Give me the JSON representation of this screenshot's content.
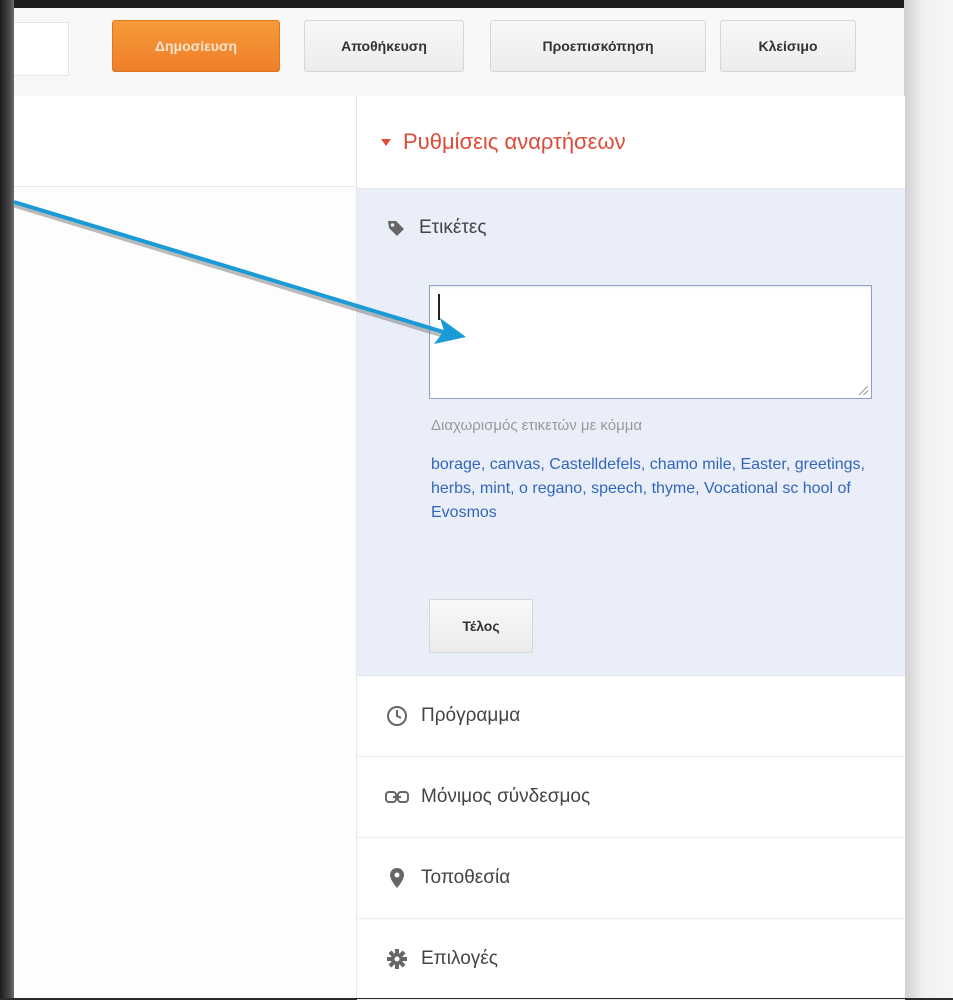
{
  "toolbar": {
    "publish_label": "Δημοσίευση",
    "save_label": "Αποθήκευση",
    "preview_label": "Προεπισκόπηση",
    "close_label": "Κλείσιμο"
  },
  "sidebar": {
    "header": "Ρυθμίσεις αναρτήσεων",
    "labels_panel": {
      "title": "Ετικέτες",
      "input_value": "",
      "hint": "Διαχωρισμός ετικετών με κόμμα",
      "suggested_labels": "borage, canvas, Castelldefels, chamo mile, Easter, greetings, herbs, mint, o regano, speech, thyme, Vocational sc hool of Evosmos",
      "done_label": "Τέλος"
    },
    "items": [
      {
        "label": "Πρόγραμμα",
        "icon": "clock-icon"
      },
      {
        "label": "Μόνιμος σύνδεσμος",
        "icon": "link-icon"
      },
      {
        "label": "Τοποθεσία",
        "icon": "location-pin-icon"
      },
      {
        "label": "Επιλογές",
        "icon": "gear-icon"
      }
    ]
  },
  "colors": {
    "accent_orange": "#f38a2f",
    "header_red": "#dd4b39",
    "link_blue": "#3366bb",
    "annotation_arrow": "#1a9ad6",
    "panel_bg": "#e9eef8"
  }
}
